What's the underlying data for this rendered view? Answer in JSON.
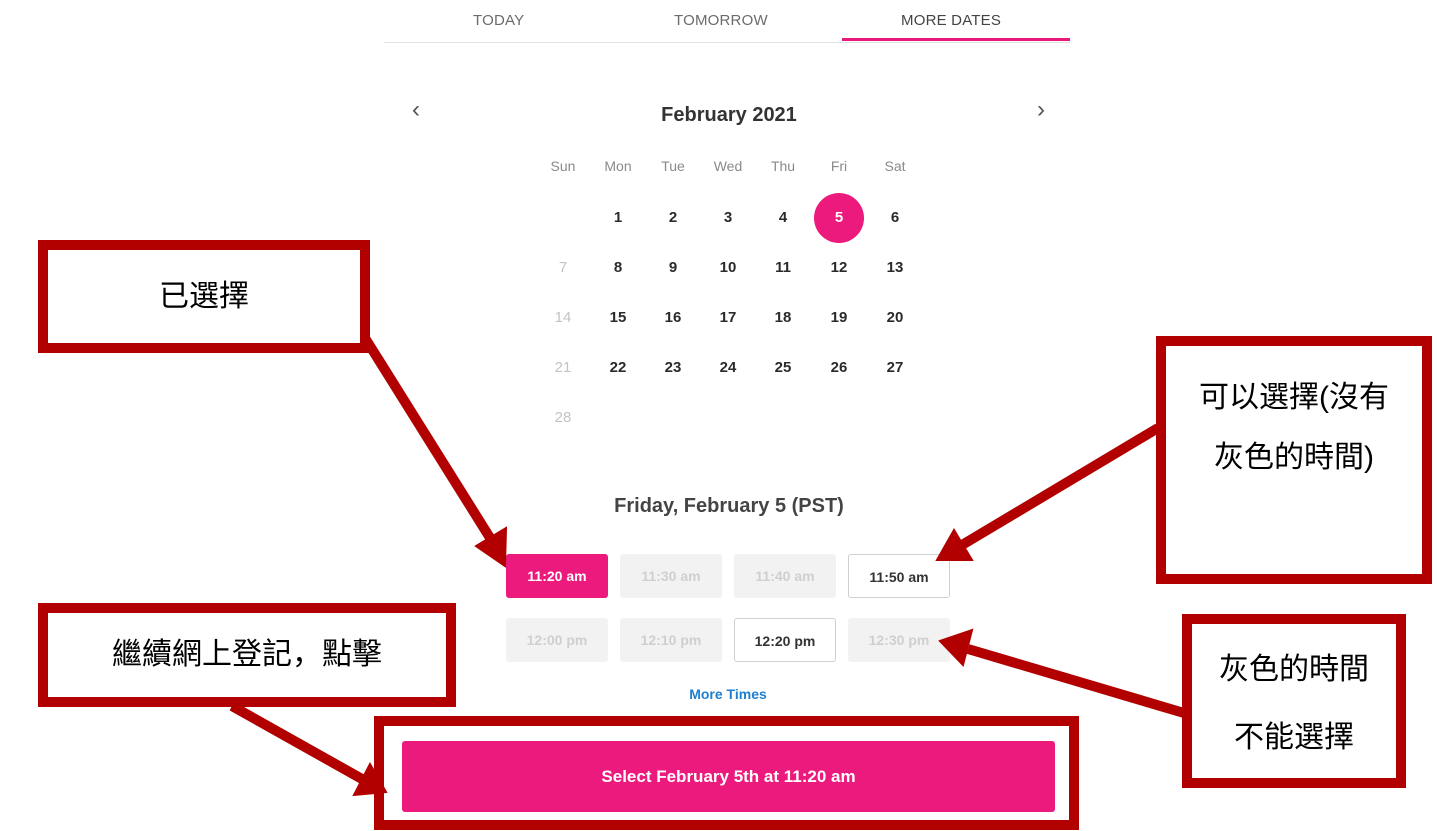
{
  "tabs": {
    "today": "TODAY",
    "tomorrow": "TOMORROW",
    "more_dates": "MORE DATES"
  },
  "calendar": {
    "month_title": "February 2021",
    "weekdays": [
      "Sun",
      "Mon",
      "Tue",
      "Wed",
      "Thu",
      "Fri",
      "Sat"
    ],
    "selected_day": "5",
    "days": [
      "1",
      "2",
      "3",
      "4",
      "5",
      "6",
      "7",
      "8",
      "9",
      "10",
      "11",
      "12",
      "13",
      "14",
      "15",
      "16",
      "17",
      "18",
      "19",
      "20",
      "21",
      "22",
      "23",
      "24",
      "25",
      "26",
      "27",
      "28"
    ]
  },
  "date_heading": "Friday, February 5 (PST)",
  "time_slots": [
    {
      "label": "11:20 am",
      "state": "selected"
    },
    {
      "label": "11:30 am",
      "state": "unavailable"
    },
    {
      "label": "11:40 am",
      "state": "unavailable"
    },
    {
      "label": "11:50 am",
      "state": "available"
    },
    {
      "label": "12:00 pm",
      "state": "unavailable"
    },
    {
      "label": "12:10 pm",
      "state": "unavailable"
    },
    {
      "label": "12:20 pm",
      "state": "available"
    },
    {
      "label": "12:30 pm",
      "state": "unavailable"
    }
  ],
  "more_times": "More Times",
  "select_button": "Select February 5th at 11:20 am",
  "annotations": {
    "selected": "已選擇",
    "selectable_line1": "可以選擇(沒有",
    "selectable_line2": "灰色的時間)",
    "continue": "繼續網上登記，點擊",
    "grey_line1": "灰色的時間",
    "grey_line2": "不能選擇"
  },
  "colors": {
    "accent": "#ec1a7d",
    "annotation": "#b20000",
    "link": "#1e7fd0"
  },
  "icons": {
    "prev": "chevron-left-icon",
    "next": "chevron-right-icon"
  }
}
